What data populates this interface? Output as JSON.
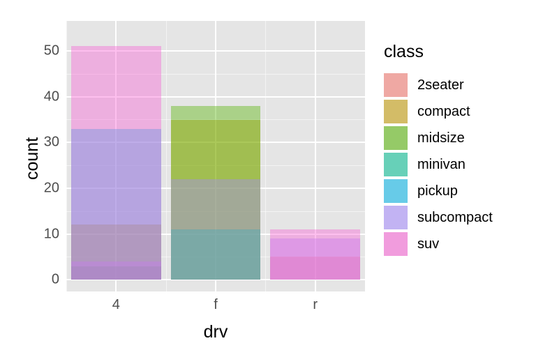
{
  "chart_data": {
    "type": "bar",
    "title": "",
    "xlabel": "drv",
    "ylabel": "count",
    "categories": [
      "4",
      "f",
      "r"
    ],
    "series": [
      {
        "name": "2seater",
        "color": "#F8766D",
        "values": [
          0,
          0,
          5
        ]
      },
      {
        "name": "compact",
        "color": "#C49A00",
        "values": [
          12,
          35,
          0
        ]
      },
      {
        "name": "midsize",
        "color": "#53B400",
        "values": [
          3,
          38,
          0
        ]
      },
      {
        "name": "minivan",
        "color": "#00C094",
        "values": [
          0,
          11,
          0
        ]
      },
      {
        "name": "pickup",
        "color": "#00B6EB",
        "values": [
          33,
          0,
          0
        ]
      },
      {
        "name": "subcompact",
        "color": "#A58AFF",
        "values": [
          4,
          22,
          9
        ]
      },
      {
        "name": "suv",
        "color": "#FB61D7",
        "values": [
          51,
          0,
          11
        ]
      }
    ],
    "y_ticks": [
      0,
      10,
      20,
      30,
      40,
      50
    ],
    "ylim": [
      0,
      54
    ],
    "legend_title": "class",
    "legend_position": "right",
    "grid": true,
    "overlay_mode": "identity"
  }
}
